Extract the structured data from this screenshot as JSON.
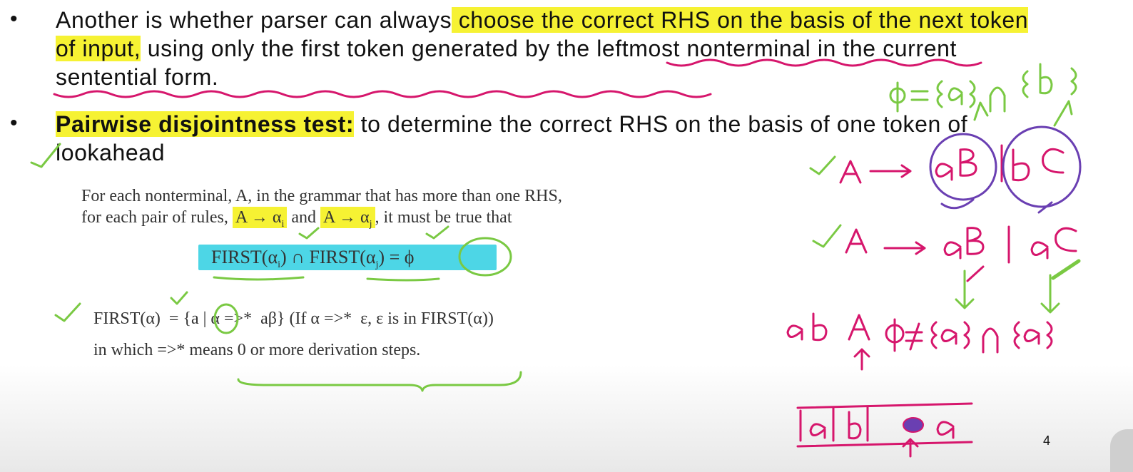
{
  "bullet1": {
    "marker": "•",
    "part1": "Another is whether parser can always",
    "highlight": " choose the correct RHS on the basis of the next token of input,",
    "part2": " using only the first token generated by the leftmost nonterminal in the current sentential form."
  },
  "bullet2": {
    "marker": "•",
    "title": "Pairwise disjointness test:",
    "text": " to determine the correct RHS on the basis of one token of lookahead"
  },
  "rule": {
    "line1": "For each nonterminal, A, in the grammar that has more than one RHS,",
    "line2_prefix": "for each pair of rules,",
    "rule_i": "A → α",
    "rule_i_sub": "i",
    "and": "and",
    "rule_j": "A → α",
    "rule_j_sub": "j",
    "line2_suffix": ", it must be true that"
  },
  "first_formula": {
    "first_i": "FIRST(α",
    "sub_i": "i",
    "close_i": ")",
    "cap": "∩",
    "first_j": "FIRST(α",
    "sub_j": "j",
    "close_j": ")",
    "eq": "=",
    "phi": "ϕ"
  },
  "definition": {
    "line1": "FIRST(α)  = {a | α =>*  aβ} (If α =>*  ε, ε is in FIRST(α))",
    "line2": "in which =>* means 0 or more derivation steps."
  },
  "page_number": "4",
  "colors": {
    "highlight_yellow": "#f6f233",
    "formula_cyan": "#4dd6e6",
    "ink_green": "#7ac943",
    "ink_magenta": "#d6166c",
    "ink_purple": "#6a3fb2"
  }
}
